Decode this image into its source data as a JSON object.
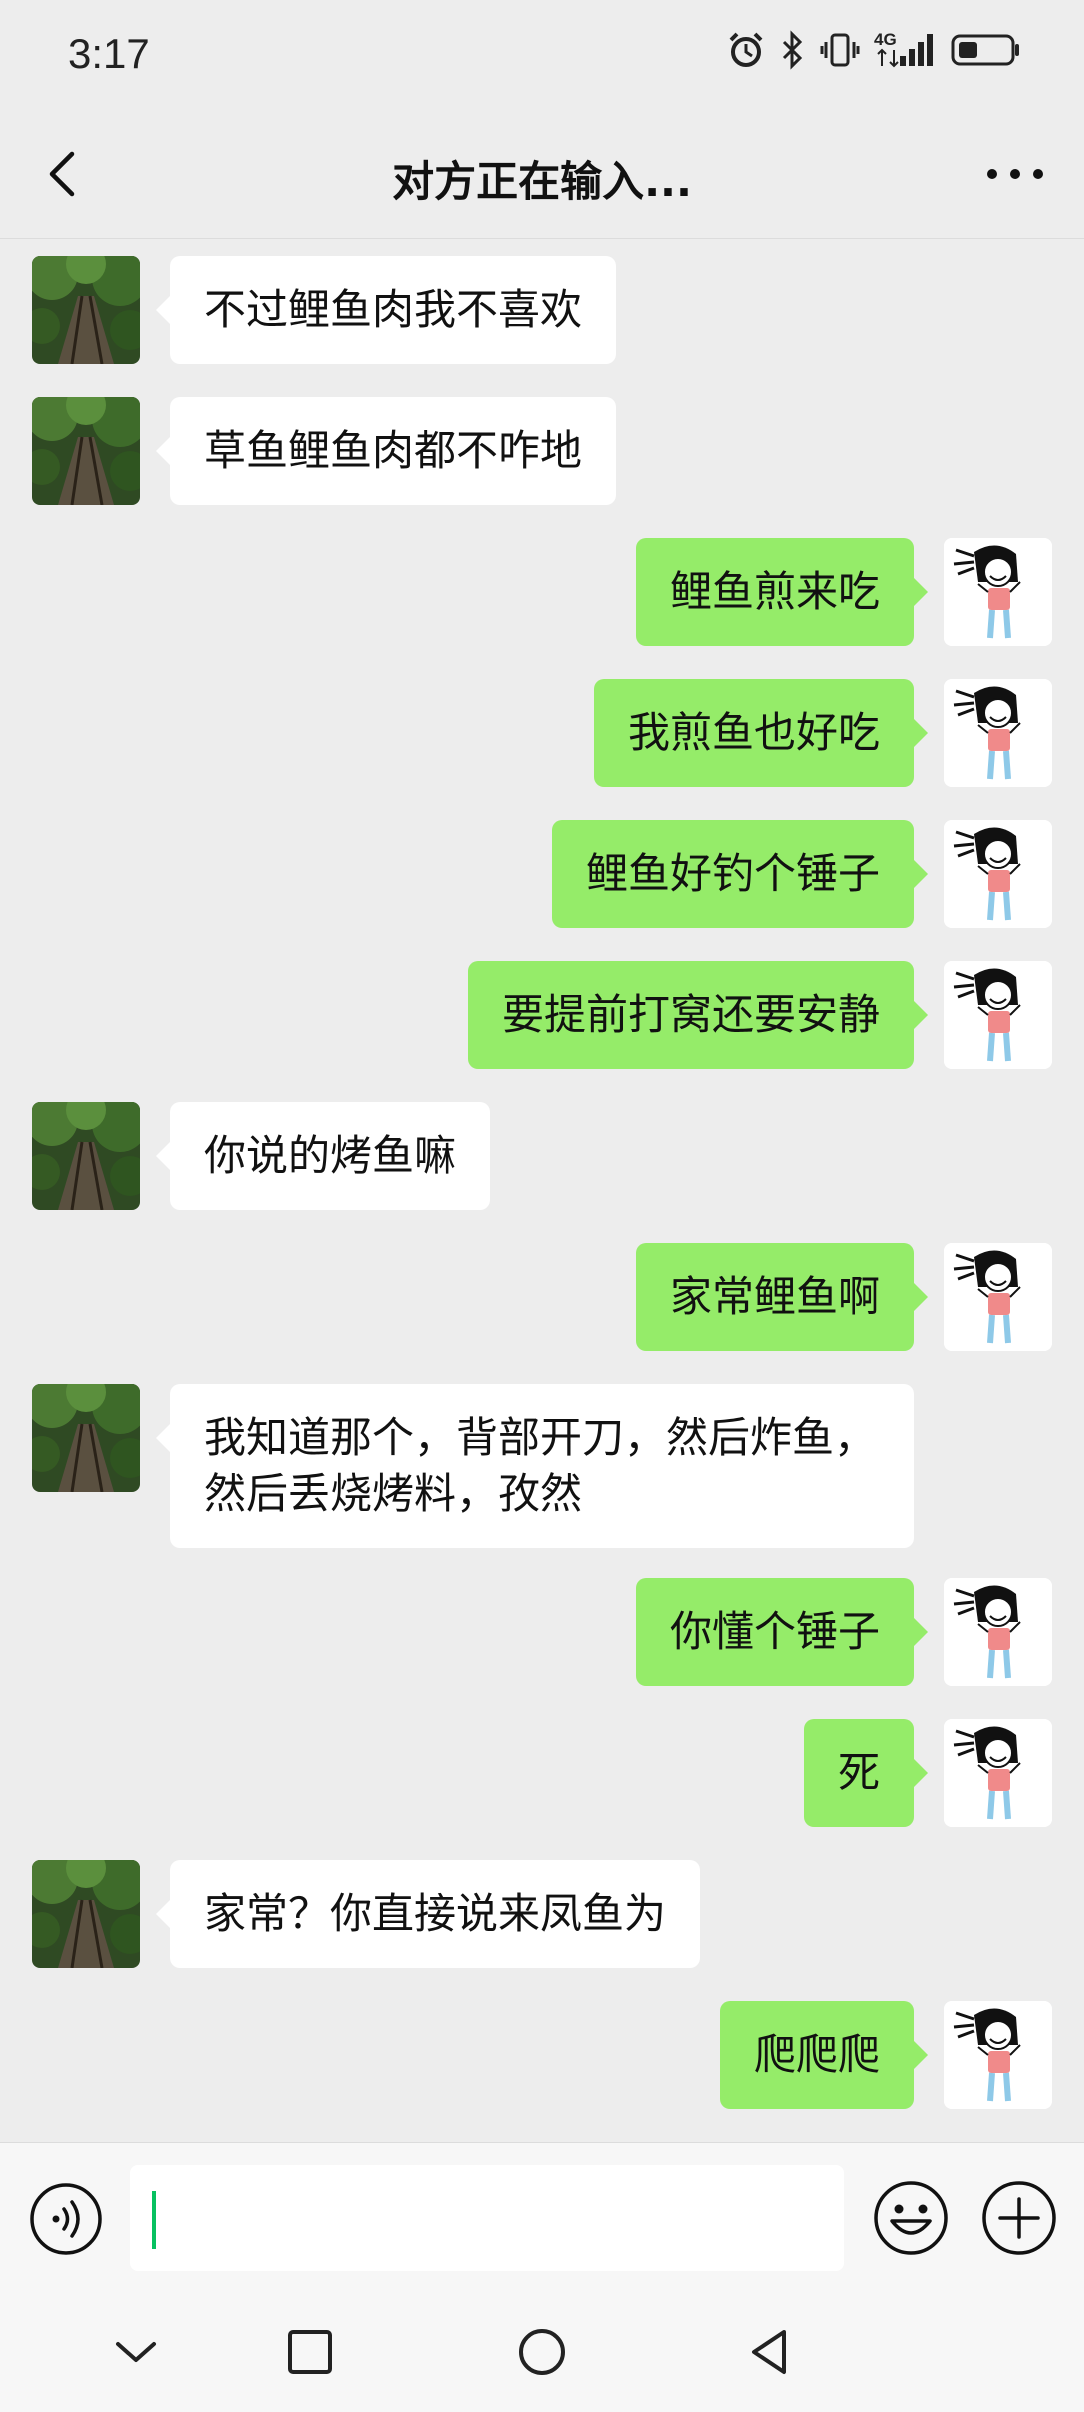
{
  "status_bar": {
    "time": "3:17",
    "network": "4G",
    "icons": [
      "alarm-icon",
      "bluetooth-icon",
      "vibrate-icon",
      "signal-icon",
      "battery-icon"
    ]
  },
  "header": {
    "title": "对方正在输入...",
    "back_icon": "chevron-left-icon",
    "more_icon": "more-dots-icon"
  },
  "colors": {
    "background": "#ededed",
    "incoming_bubble": "#ffffff",
    "outgoing_bubble": "#95ec69",
    "cursor": "#07c160"
  },
  "messages": [
    {
      "side": "in",
      "text": "不过鲤鱼肉我不喜欢"
    },
    {
      "side": "in",
      "text": "草鱼鲤鱼肉都不咋地"
    },
    {
      "side": "out",
      "text": "鲤鱼煎来吃"
    },
    {
      "side": "out",
      "text": "我煎鱼也好吃"
    },
    {
      "side": "out",
      "text": "鲤鱼好钓个锤子"
    },
    {
      "side": "out",
      "text": "要提前打窝还要安静"
    },
    {
      "side": "in",
      "text": "你说的烤鱼嘛"
    },
    {
      "side": "out",
      "text": "家常鲤鱼啊"
    },
    {
      "side": "in",
      "text": "我知道那个，背部开刀，然后炸鱼，然后丢烧烤料，孜然"
    },
    {
      "side": "out",
      "text": "你懂个锤子"
    },
    {
      "side": "out",
      "text": "死"
    },
    {
      "side": "in",
      "text": "家常？你直接说来凤鱼为"
    },
    {
      "side": "out",
      "text": "爬爬爬"
    }
  ],
  "input_bar": {
    "value": "",
    "voice_icon": "voice-icon",
    "emoji_icon": "emoji-icon",
    "plus_icon": "plus-icon"
  },
  "system_nav": {
    "icons": [
      "collapse-down-icon",
      "recents-square-icon",
      "home-circle-icon",
      "back-triangle-icon"
    ]
  }
}
